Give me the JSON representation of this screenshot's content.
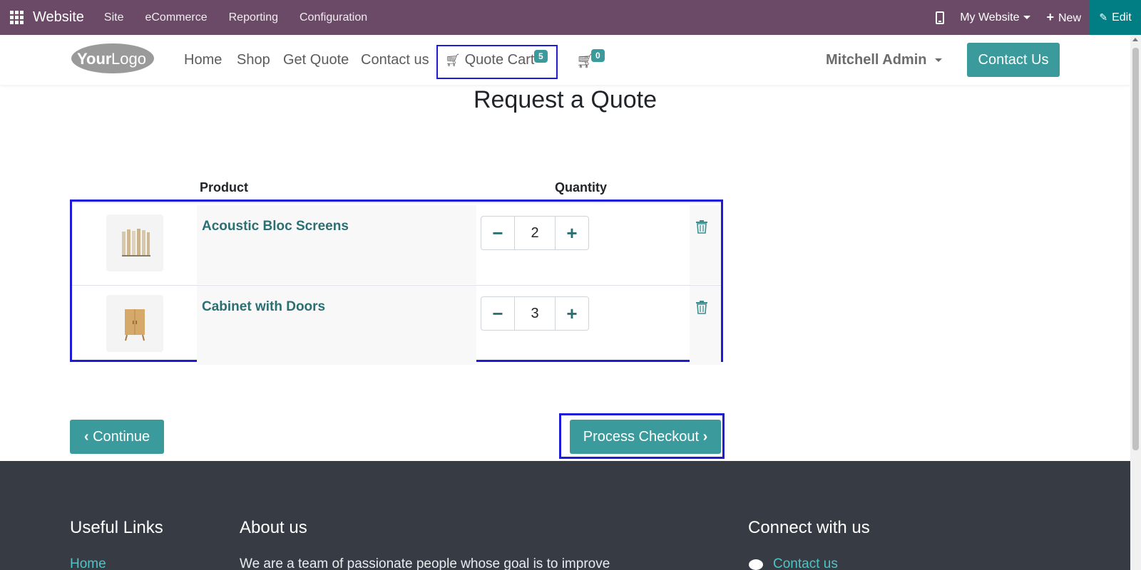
{
  "admin_bar": {
    "app_title": "Website",
    "menus": [
      "Site",
      "eCommerce",
      "Reporting",
      "Configuration"
    ],
    "site_selector": "My Website",
    "new_label": "New",
    "edit_label": "Edit"
  },
  "header": {
    "logo_text_bold": "Your",
    "logo_text_light": "Logo",
    "nav": [
      "Home",
      "Shop",
      "Get Quote",
      "Contact us"
    ],
    "quote_cart_label": "Quote Cart",
    "quote_cart_count": "5",
    "cart_count": "0",
    "user_name": "Mitchell Admin",
    "contact_button": "Contact Us"
  },
  "main": {
    "title": "Request a Quote",
    "columns": {
      "product": "Product",
      "quantity": "Quantity"
    },
    "items": [
      {
        "name": "Acoustic Bloc Screens",
        "quantity": "2"
      },
      {
        "name": "Cabinet with Doors",
        "quantity": "3"
      }
    ],
    "continue_label": "Continue",
    "checkout_label": "Process Checkout"
  },
  "footer": {
    "useful_links_title": "Useful Links",
    "useful_links_first": "Home",
    "about_title": "About us",
    "about_text": "We are a team of passionate people whose goal is to improve",
    "connect_title": "Connect with us",
    "connect_first": "Contact us"
  },
  "colors": {
    "admin_bar": "#6b4a67",
    "edit_button": "#017e84",
    "primary": "#3b9a9c",
    "product_link": "#2b6f73",
    "highlight_border": "#1d1bd6",
    "footer_bg": "#373c44"
  },
  "icons": [
    "apps-grid-icon",
    "mobile-icon",
    "plus-icon",
    "pencil-icon",
    "shopping-cart-icon",
    "minus-icon",
    "trash-icon",
    "chevron-left-icon",
    "chevron-right-icon",
    "comment-icon"
  ]
}
